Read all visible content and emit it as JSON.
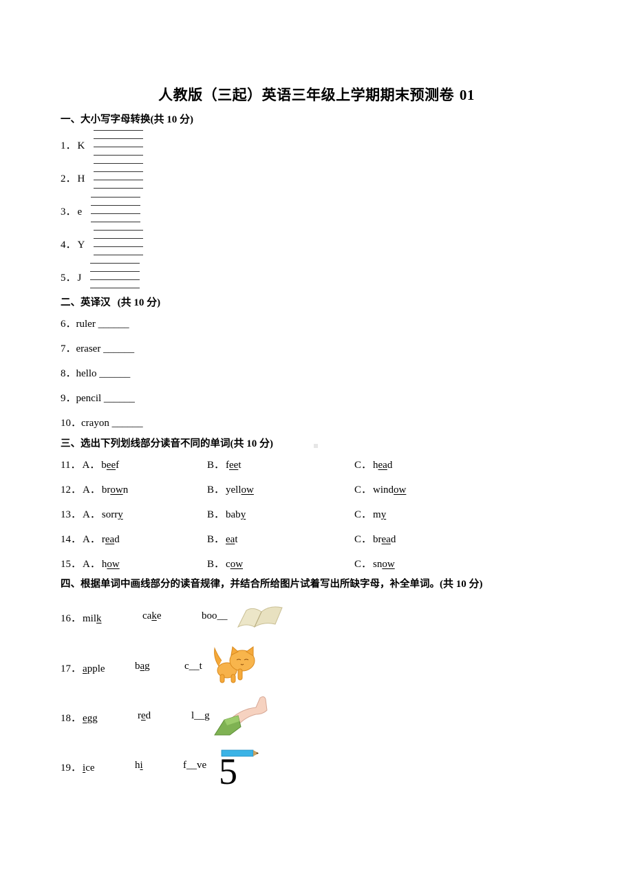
{
  "document": {
    "title": "人教版（三起）英语三年级上学期期末预测卷",
    "title_number": "01"
  },
  "section1": {
    "heading": "一、大小写字母转换",
    "score": "(共 10 分)",
    "items": [
      {
        "num": "1．",
        "letter": "K"
      },
      {
        "num": "2．",
        "letter": "H"
      },
      {
        "num": "3．",
        "letter": "e"
      },
      {
        "num": "4．",
        "letter": "Y"
      },
      {
        "num": "5．",
        "letter": "J"
      }
    ]
  },
  "section2": {
    "heading": "二、英译汉",
    "score": "(共 10 分)",
    "items": [
      {
        "num": "6．",
        "word": "ruler",
        "blank": "______"
      },
      {
        "num": "7．",
        "word": "eraser",
        "blank": "______"
      },
      {
        "num": "8．",
        "word": "hello",
        "blank": "______"
      },
      {
        "num": "9．",
        "word": "pencil",
        "blank": "______"
      },
      {
        "num": "10．",
        "word": "crayon",
        "blank": "______"
      }
    ]
  },
  "section3": {
    "heading": "三、选出下列划线部分读音不同的单词",
    "score": "(共 10 分)",
    "items": [
      {
        "num": "11．",
        "options": [
          {
            "label": "A．",
            "pre": "b",
            "u": "ee",
            "post": "f"
          },
          {
            "label": "B．",
            "pre": "f",
            "u": "ee",
            "post": "t"
          },
          {
            "label": "C．",
            "pre": "h",
            "u": "ea",
            "post": "d"
          }
        ]
      },
      {
        "num": "12．",
        "options": [
          {
            "label": "A．",
            "pre": "br",
            "u": "ow",
            "post": "n"
          },
          {
            "label": "B．",
            "pre": "yell",
            "u": "ow",
            "post": ""
          },
          {
            "label": "C．",
            "pre": "wind",
            "u": "ow",
            "post": ""
          }
        ]
      },
      {
        "num": "13．",
        "options": [
          {
            "label": "A．",
            "pre": "sorr",
            "u": "y",
            "post": ""
          },
          {
            "label": "B．",
            "pre": "bab",
            "u": "y",
            "post": ""
          },
          {
            "label": "C．",
            "pre": "m",
            "u": "y",
            "post": ""
          }
        ]
      },
      {
        "num": "14．",
        "options": [
          {
            "label": "A．",
            "pre": "r",
            "u": "ea",
            "post": "d"
          },
          {
            "label": "B．",
            "pre": "",
            "u": "ea",
            "post": "t"
          },
          {
            "label": "C．",
            "pre": "br",
            "u": "ea",
            "post": "d"
          }
        ]
      },
      {
        "num": "15．",
        "options": [
          {
            "label": "A．",
            "pre": "h",
            "u": "ow",
            "post": ""
          },
          {
            "label": "B．",
            "pre": "c",
            "u": "ow",
            "post": ""
          },
          {
            "label": "C．",
            "pre": "sn",
            "u": "ow",
            "post": ""
          }
        ]
      }
    ]
  },
  "section4": {
    "heading": "四、根据单词中画线部分的读音规律，并结合所给图片试着写出所缺字母，补全单词。",
    "score": "(共 10 分)",
    "items": [
      {
        "num": "16．",
        "w1": {
          "pre": "mil",
          "u": "k",
          "post": ""
        },
        "w2": {
          "pre": "ca",
          "u": "k",
          "post": "e"
        },
        "blank": "boo__",
        "picture": "book-icon"
      },
      {
        "num": "17．",
        "w1": {
          "pre": "",
          "u": "a",
          "post": "pple"
        },
        "w2": {
          "pre": "b",
          "u": "a",
          "post": "g"
        },
        "blank": "c__t",
        "picture": "cat-icon"
      },
      {
        "num": "18．",
        "w1": {
          "pre": "",
          "u": "e",
          "post": "gg"
        },
        "w2": {
          "pre": "r",
          "u": "e",
          "post": "d"
        },
        "blank": "l__g",
        "picture": "leg-icon"
      },
      {
        "num": "19．",
        "w1": {
          "pre": "",
          "u": "i",
          "post": "ce"
        },
        "w2": {
          "pre": "h",
          "u": "i",
          "post": ""
        },
        "blank": "f__ve",
        "picture": "five-icon",
        "picture_text": "5"
      }
    ]
  }
}
